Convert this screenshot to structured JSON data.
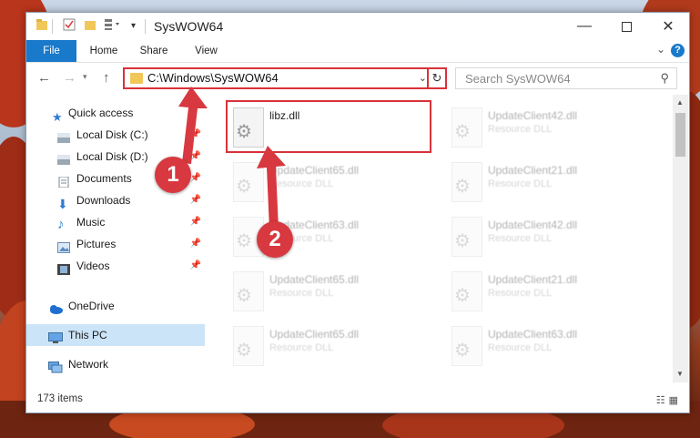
{
  "window": {
    "title": "SysWOW64"
  },
  "ribbon": {
    "tabs": [
      "File",
      "Home",
      "Share",
      "View"
    ]
  },
  "address": {
    "path": "C:\\Windows\\SysWOW64"
  },
  "search": {
    "placeholder": "Search SysWOW64"
  },
  "sidebar": {
    "items": [
      {
        "label": "Quick access",
        "icon": "star-icon"
      },
      {
        "label": "Local Disk (C:)",
        "icon": "drive-icon"
      },
      {
        "label": "Local Disk (D:)",
        "icon": "drive-icon"
      },
      {
        "label": "Documents",
        "icon": "documents-icon"
      },
      {
        "label": "Downloads",
        "icon": "download-icon"
      },
      {
        "label": "Music",
        "icon": "music-icon"
      },
      {
        "label": "Pictures",
        "icon": "pictures-icon"
      },
      {
        "label": "Videos",
        "icon": "videos-icon"
      },
      {
        "label": "OneDrive",
        "icon": "cloud-icon"
      },
      {
        "label": "This PC",
        "icon": "computer-icon"
      },
      {
        "label": "Network",
        "icon": "network-icon"
      }
    ]
  },
  "files": [
    {
      "name": "libz.dll",
      "type": ""
    },
    {
      "name": "UpdateClient42.dll",
      "type": "Resource DLL"
    },
    {
      "name": "UpdateClient65.dll",
      "type": "Resource DLL"
    },
    {
      "name": "UpdateClient21.dll",
      "type": "Resource DLL"
    },
    {
      "name": "UpdateClient63.dll",
      "type": "Resource DLL"
    },
    {
      "name": "UpdateClient42.dll",
      "type": "Resource DLL"
    },
    {
      "name": "UpdateClient65.dll",
      "type": "Resource DLL"
    },
    {
      "name": "UpdateClient21.dll",
      "type": "Resource DLL"
    },
    {
      "name": "UpdateClient65.dll",
      "type": "Resource DLL"
    },
    {
      "name": "UpdateClient63.dll",
      "type": "Resource DLL"
    }
  ],
  "status": {
    "count": "173 items"
  },
  "steps": [
    "1",
    "2"
  ],
  "colors": {
    "accent": "#1979ca",
    "highlight": "#d9323a"
  }
}
